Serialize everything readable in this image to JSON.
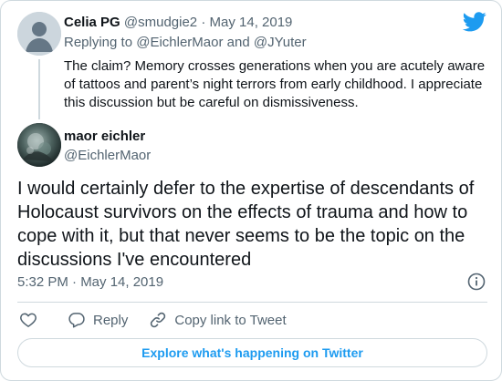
{
  "parent_tweet": {
    "name": "Celia PG",
    "handle": "@smudgie2",
    "separator": "·",
    "date": "May 14, 2019",
    "replying_prefix": "Replying to",
    "replying_to_1": "@EichlerMaor",
    "replying_and": "and",
    "replying_to_2": "@JYuter",
    "text": "The claim? Memory crosses generations when you are acutely aware of tattoos and parent’s night terrors from early childhood. I appreciate this discussion but be careful on dismissiveness."
  },
  "main_tweet": {
    "name": "maor eichler",
    "handle": "@EichlerMaor",
    "text": "I would certainly defer to the expertise of descendants of Holocaust survivors on the effects of trauma and how to cope with it, but that never seems to be the topic on the discussions I've encountered",
    "timestamp": "5:32 PM · May 14, 2019"
  },
  "actions": {
    "reply_label": "Reply",
    "copy_link_label": "Copy link to Tweet"
  },
  "explore_label": "Explore what's happening on Twitter",
  "icons": {
    "brand": "twitter-bird-icon",
    "like": "heart-icon",
    "reply": "speech-bubble-icon",
    "copy": "link-icon",
    "info": "info-icon"
  },
  "colors": {
    "brand_blue": "#1d9bf0",
    "muted": "#536471",
    "border": "#cfd9de"
  }
}
